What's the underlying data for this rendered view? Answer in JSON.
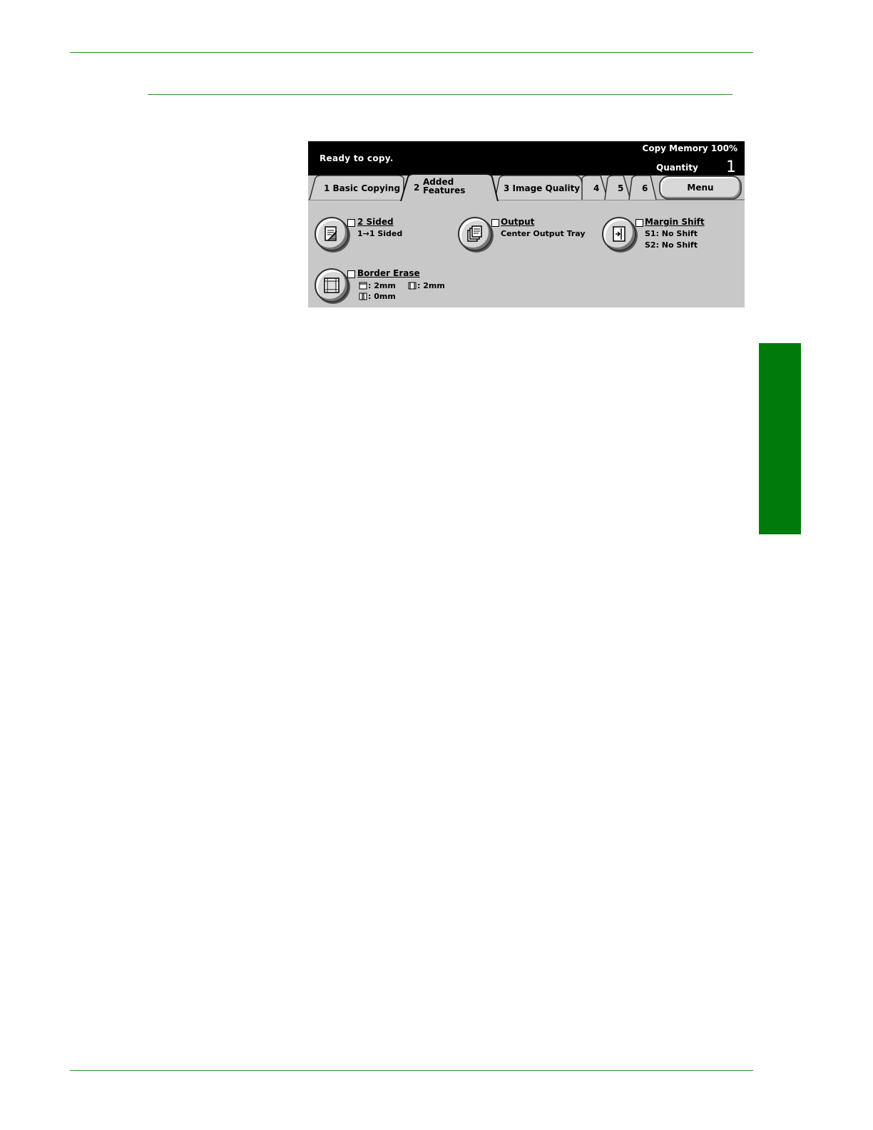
{
  "colors": {
    "rule": "#2e8b2e",
    "side_tab": "#007a0b",
    "panel": "#c8c8c8",
    "status_bar": "#000000"
  },
  "status": {
    "message": "Ready to copy.",
    "memory": "Copy Memory 100%",
    "quantity_label": "Quantity",
    "quantity_value": "1"
  },
  "tabs": [
    {
      "label": "1 Basic Copying"
    },
    {
      "number": "2",
      "line1": "Added",
      "line2": "Features",
      "active": true
    },
    {
      "label": "3 Image Quality"
    },
    {
      "label": "4"
    },
    {
      "label": "5"
    },
    {
      "label": "6"
    }
  ],
  "menu_label": "Menu",
  "features": {
    "two_sided": {
      "icon": "two-sided-icon",
      "title": "2 Sided",
      "value": "1→1 Sided",
      "checked": false
    },
    "output": {
      "icon": "output-icon",
      "title": "Output",
      "value": "Center Output Tray",
      "checked": false
    },
    "margin_shift": {
      "icon": "margin-shift-icon",
      "title": "Margin Shift",
      "side1": "S1: No Shift",
      "side2": "S2: No Shift",
      "checked": false
    },
    "border_erase": {
      "icon": "border-erase-icon",
      "title": "Border Erase",
      "top_bottom": ": 2mm",
      "left_right": ": 2mm",
      "center": ": 0mm",
      "checked": false
    }
  }
}
